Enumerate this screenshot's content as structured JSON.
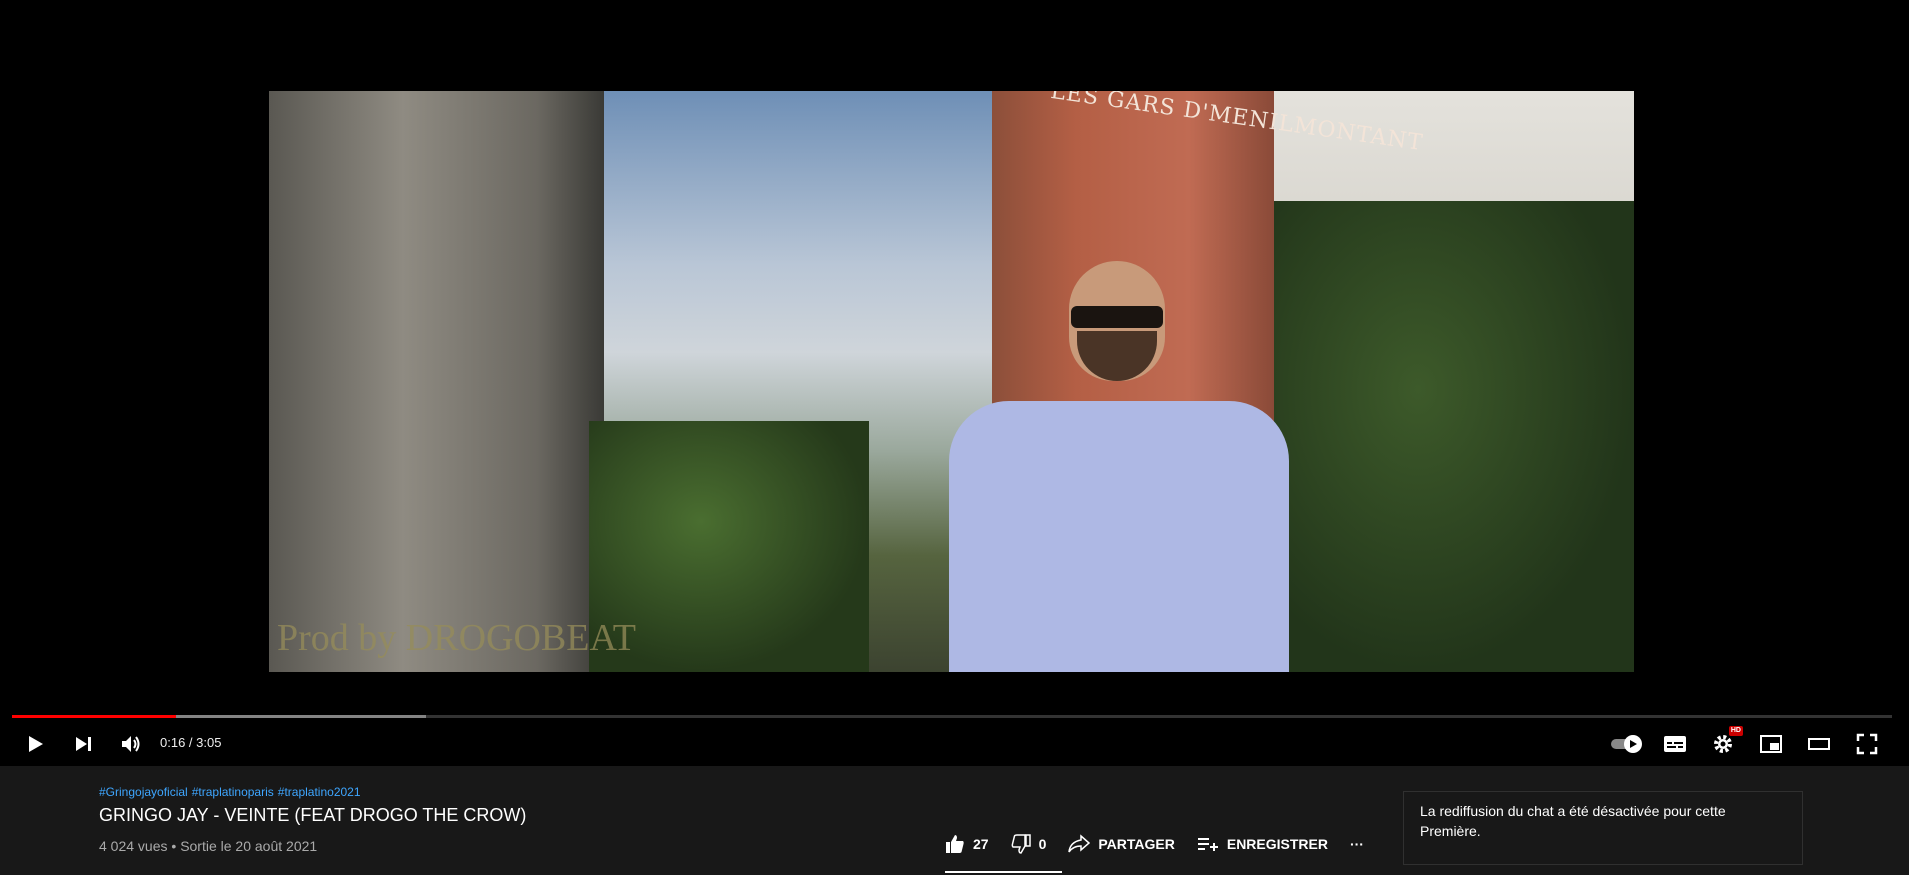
{
  "player": {
    "watermark": "Prod by DROGOBEAT",
    "mural_text": "LES GARS D'MENILMONTANT",
    "progress": {
      "played_fraction": 0.087,
      "buffered_fraction": 0.22
    },
    "controls": {
      "time": "0:16 / 3:05",
      "hd_badge": "HD",
      "icons": [
        "play-icon",
        "next-icon",
        "volume-icon",
        "autoplay-toggle-icon",
        "subtitles-icon",
        "settings-icon",
        "miniplayer-icon",
        "theater-icon",
        "fullscreen-icon"
      ]
    }
  },
  "video_info": {
    "hashtags": [
      "#Gringojayoficial",
      "#traplatinoparis",
      "#traplatino2021"
    ],
    "title": "GRINGO JAY - VEINTE (FEAT DROGO THE CROW)",
    "views": "4 024 vues",
    "separator": "•",
    "release": "Sortie le 20 août 2021"
  },
  "actions": {
    "likes": "27",
    "dislikes": "0",
    "share_label": "PARTAGER",
    "save_label": "ENREGISTRER",
    "more_label": "···"
  },
  "chat": {
    "message": "La rediffusion du chat a été désactivée pour cette Première."
  },
  "colors": {
    "accent_red": "#ff0000",
    "link_blue": "#3ea6ff",
    "background": "#181818"
  }
}
